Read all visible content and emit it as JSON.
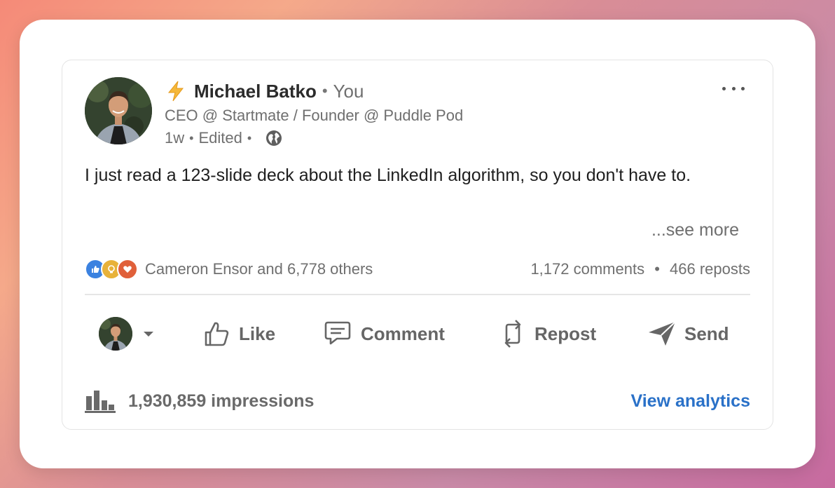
{
  "post": {
    "author": {
      "name": "Michael Batko",
      "relation": "You",
      "headline": "CEO @ Startmate / Founder @ Puddle Pod",
      "time": "1w",
      "edited": "Edited",
      "visibility_icon": "globe-icon",
      "name_emoji_icon": "lightning-bolt-icon"
    },
    "text": "I just read a 123-slide deck about the LinkedIn algorithm, so you don't have to.",
    "see_more": "...see more",
    "reactions": {
      "icons": [
        "like-reaction-icon",
        "insightful-reaction-icon",
        "love-reaction-icon"
      ],
      "summary": "Cameron Ensor and 6,778 others",
      "comments": "1,172 comments",
      "reposts": "466 reposts"
    },
    "actions": {
      "like": "Like",
      "comment": "Comment",
      "repost": "Repost",
      "send": "Send"
    },
    "impressions": "1,930,859 impressions",
    "view_analytics": "View analytics"
  },
  "colors": {
    "link_blue": "#2a71c8",
    "text_primary": "#1f1f1f",
    "text_secondary": "#6f6f6f",
    "bolt": "#f2b233"
  }
}
